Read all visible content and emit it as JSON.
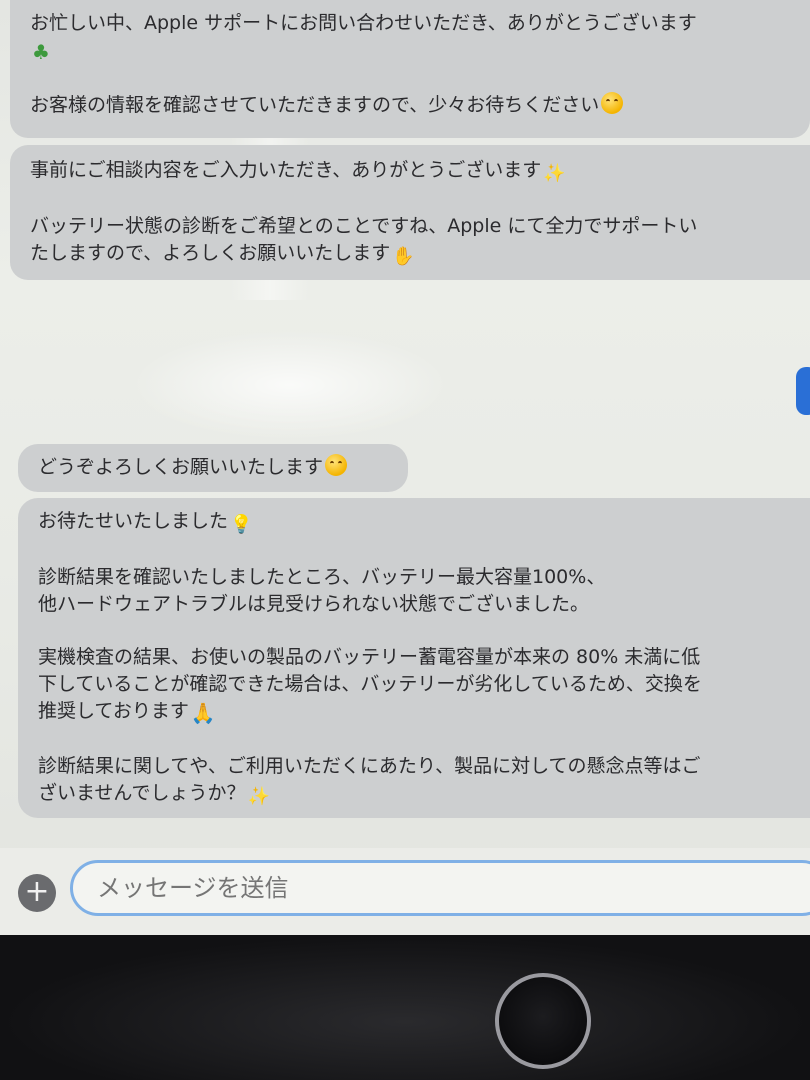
{
  "chat": {
    "msg1": {
      "line1": "お忙しい中、Apple サポートにお問い合わせいただき、ありがとうございます",
      "line2": "お客様の情報を確認させていただきますので、少々お待ちください"
    },
    "msg2": {
      "line1": "事前にご相談内容をご入力いただき、ありがとうございます",
      "line2": "バッテリー状態の診断をご希望とのことですね、Apple にて全力でサポートい",
      "line3": "たしますので、よろしくお願いいたします"
    },
    "msg3": {
      "line1": "どうぞよろしくお願いいたします"
    },
    "msg4": {
      "line1": "お待たせいたしました",
      "line2": "診断結果を確認いたしましたところ、バッテリー最大容量100%、",
      "line3": "他ハードウェアトラブルは見受けられない状態でございました。",
      "line4": "実機検査の結果、お使いの製品のバッテリー蓄電容量が本来の 80% 未満に低",
      "line5": "下していることが確認できた場合は、バッテリーが劣化しているため、交換を",
      "line6": "推奨しております",
      "line7": "診断結果に関してや、ご利用いただくにあたり、製品に対しての懸念点等はご",
      "line8": "ざいませんでしょうか？"
    }
  },
  "composer": {
    "placeholder": "メッセージを送信",
    "add_label": "+"
  },
  "icons": [
    "clover-icon",
    "smile-icon",
    "sparkle-icon",
    "handshake-icon",
    "lightbulb-icon",
    "pray-icon",
    "plus-icon"
  ],
  "colors": {
    "incoming_bubble": "#cdcfd0",
    "input_border": "#7fb0e6",
    "side_tab": "#2a6fd6"
  }
}
